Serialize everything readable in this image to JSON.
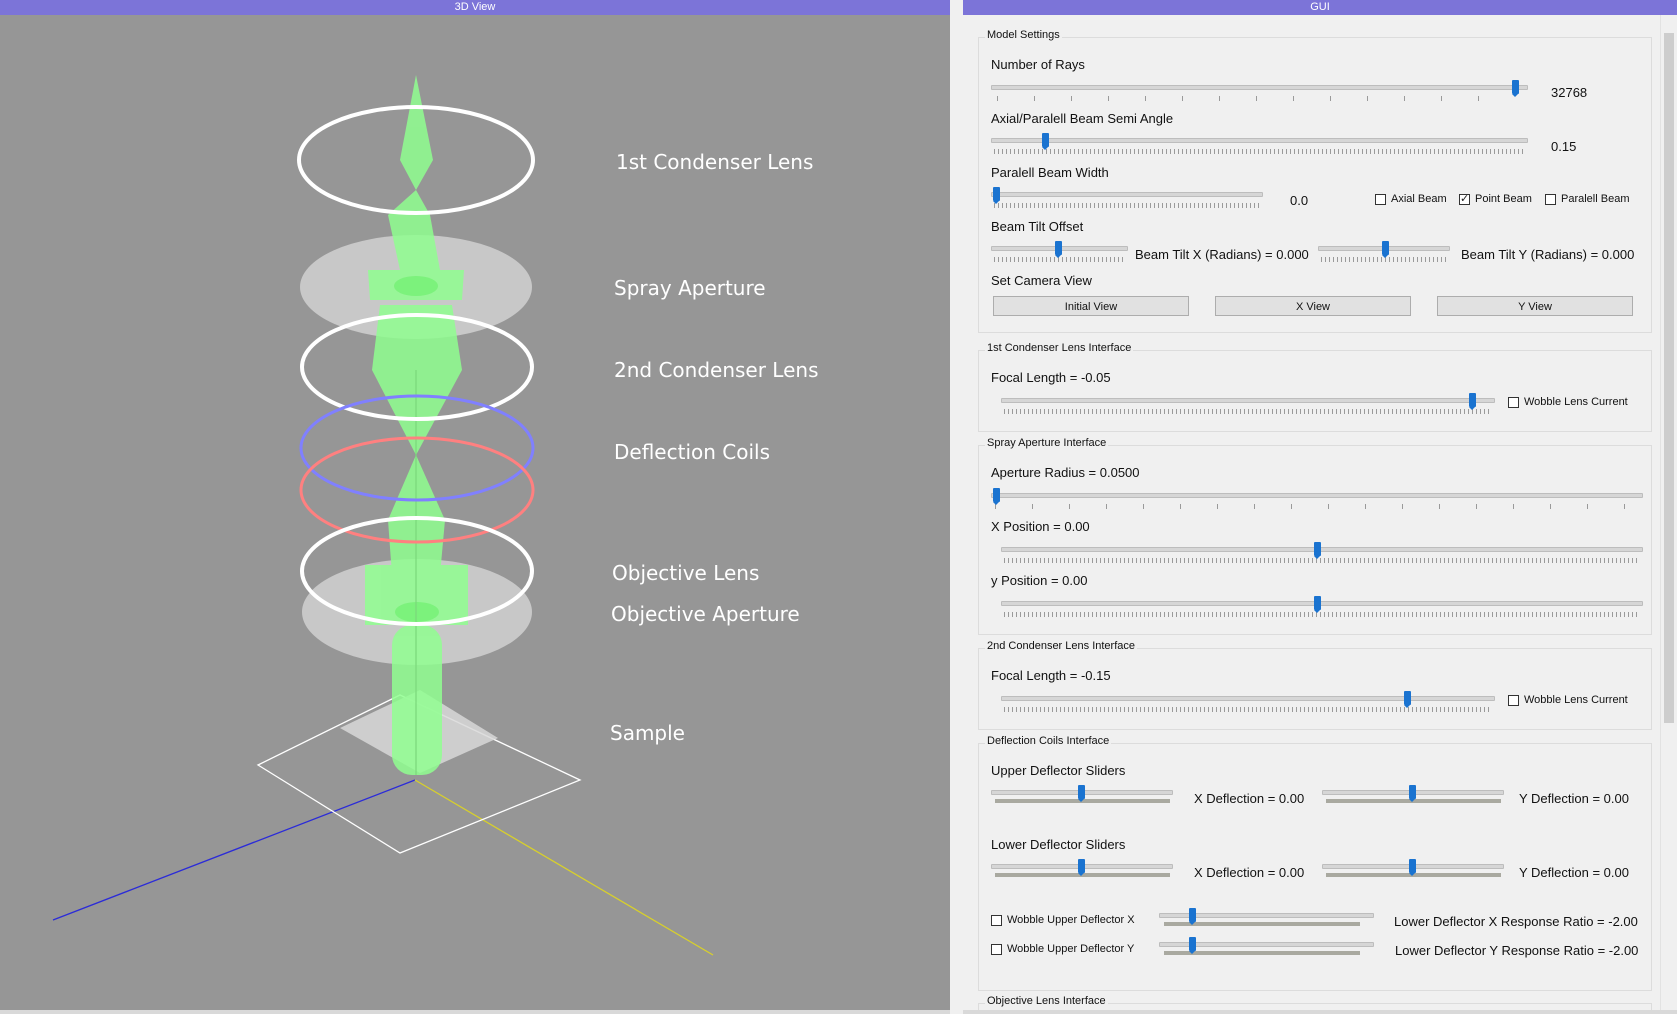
{
  "panes": {
    "left_title": "3D View",
    "right_title": "GUI"
  },
  "scene_labels": {
    "c1": "1st Condenser Lens",
    "spray": "Spray Aperture",
    "c2": "2nd Condenser Lens",
    "defl": "Deflection Coils",
    "obj": "Objective Lens",
    "obj_ap": "Objective Aperture",
    "sample": "Sample"
  },
  "model": {
    "title": "Model Settings",
    "rays_label": "Number of Rays",
    "rays_value": "32768",
    "semi_label": "Axial/Paralell Beam Semi Angle",
    "semi_value": "0.15",
    "width_label": "Paralell Beam Width",
    "width_value": "0.0",
    "axial_beam": "Axial Beam",
    "point_beam": "Point Beam",
    "paralell_beam": "Paralell Beam",
    "tilt_label": "Beam Tilt Offset",
    "tilt_x": "Beam Tilt X (Radians) = 0.000",
    "tilt_y": "Beam Tilt Y (Radians) = 0.000",
    "camera_label": "Set Camera View",
    "btn_initial": "Initial View",
    "btn_x": "X View",
    "btn_y": "Y View",
    "point_beam_checked": true
  },
  "c1": {
    "title": "1st Condenser Lens Interface",
    "focal": "Focal Length = -0.05",
    "wobble": "Wobble Lens Current"
  },
  "spray": {
    "title": "Spray Aperture Interface",
    "radius": "Aperture Radius = 0.0500",
    "xpos": "X Position = 0.00",
    "ypos": "y Position = 0.00"
  },
  "c2": {
    "title": "2nd Condenser Lens Interface",
    "focal": "Focal Length = -0.15",
    "wobble": "Wobble Lens Current"
  },
  "defl": {
    "title": "Deflection Coils Interface",
    "upper": "Upper Deflector Sliders",
    "lower": "Lower Deflector Sliders",
    "ux": "X Deflection = 0.00",
    "uy": "Y Deflection = 0.00",
    "lx": "X Deflection = 0.00",
    "ly": "Y Deflection = 0.00",
    "wob_x": "Wobble Upper Deflector X",
    "wob_y": "Wobble Upper Deflector Y",
    "ratio_x": "Lower Deflector X Response Ratio = -2.00",
    "ratio_y": "Lower Deflector Y Response Ratio = -2.00"
  },
  "obj": {
    "title": "Objective Lens Interface"
  },
  "colors": {
    "title_bar": "#7c74d8",
    "beam": "#8cff8c",
    "slider": "#1a73d0",
    "coil_upper": "#8080ff",
    "coil_lower": "#ff7f7f"
  }
}
